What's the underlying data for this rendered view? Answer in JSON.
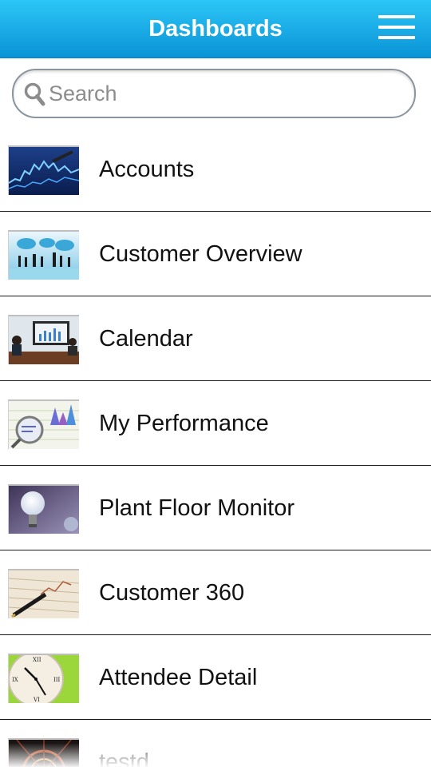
{
  "header": {
    "title": "Dashboards",
    "menu_icon": "hamburger-menu-icon"
  },
  "search": {
    "placeholder": "Search",
    "value": "",
    "icon": "search-icon"
  },
  "colors": {
    "header_top": "#2cc6f7",
    "header_bottom": "#0a93d6",
    "divider": "#1a1a1a"
  },
  "dashboards": [
    {
      "label": "Accounts",
      "thumbnail": "stock-chart-thumbnail"
    },
    {
      "label": "Customer Overview",
      "thumbnail": "world-map-people-thumbnail"
    },
    {
      "label": "Calendar",
      "thumbnail": "meeting-room-thumbnail"
    },
    {
      "label": "My Performance",
      "thumbnail": "magnified-chart-thumbnail"
    },
    {
      "label": "Plant Floor Monitor",
      "thumbnail": "light-bulb-thumbnail"
    },
    {
      "label": "Customer 360",
      "thumbnail": "pen-on-chart-thumbnail"
    },
    {
      "label": "Attendee Detail",
      "thumbnail": "clock-thumbnail"
    },
    {
      "label": "testd",
      "thumbnail": "abstract-thumbnail"
    }
  ]
}
